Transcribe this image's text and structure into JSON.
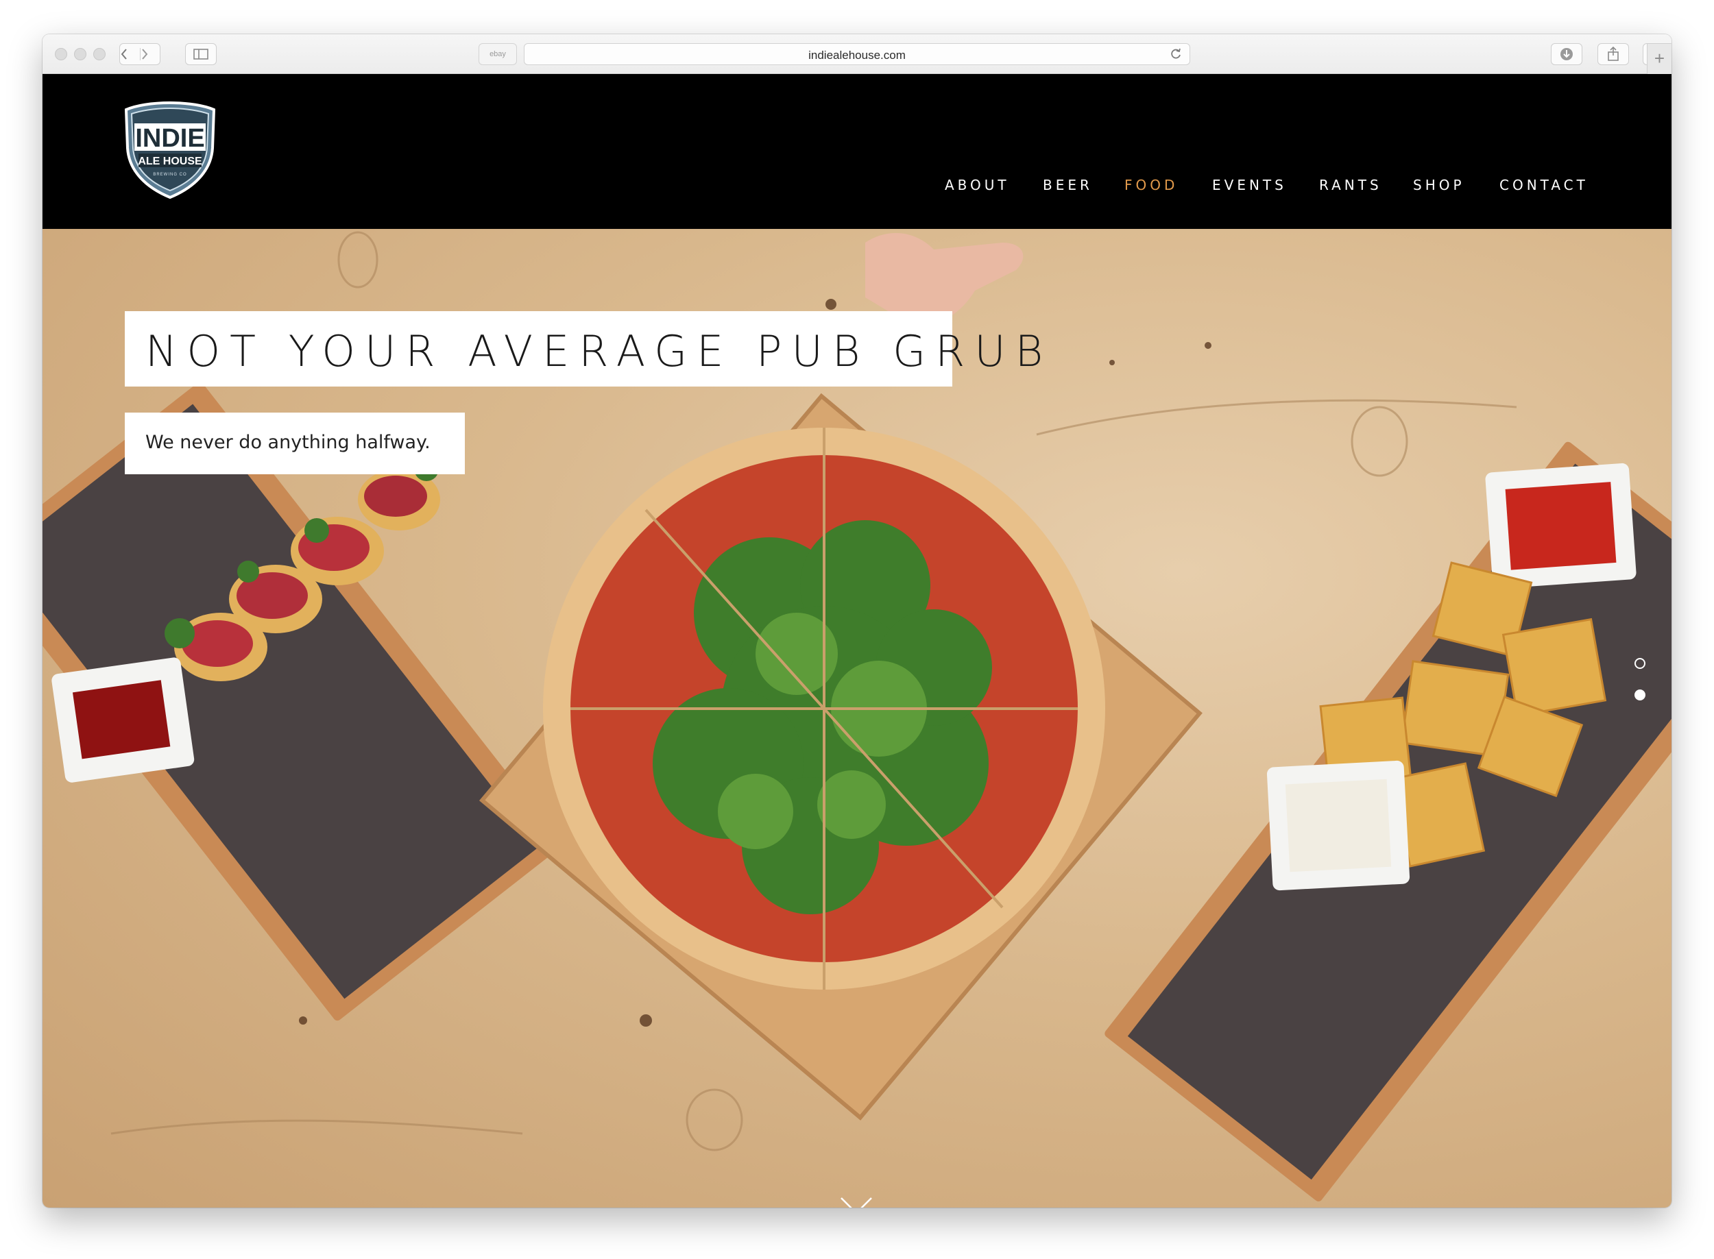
{
  "browser": {
    "url": "indiealehouse.com",
    "favorites_label": "ebay"
  },
  "site": {
    "logo": {
      "line1": "INDIE",
      "line2": "ALE HOUSE",
      "line3": "BREWING CO"
    },
    "nav": [
      {
        "label": "ABOUT",
        "active": false
      },
      {
        "label": "BEER",
        "active": false
      },
      {
        "label": "FOOD",
        "active": true
      },
      {
        "label": "EVENTS",
        "active": false
      },
      {
        "label": "RANTS",
        "active": false
      },
      {
        "label": "SHOP",
        "active": false
      },
      {
        "label": "CONTACT",
        "active": false
      }
    ],
    "accent_color": "#e29a4b",
    "header_bg": "#000000"
  },
  "hero": {
    "title": "NOT YOUR AVERAGE PUB GRUB",
    "subtitle": "We never do anything halfway.",
    "slides": {
      "count": 2,
      "current": 2
    },
    "scroll_icon": "chevron-down-icon"
  }
}
